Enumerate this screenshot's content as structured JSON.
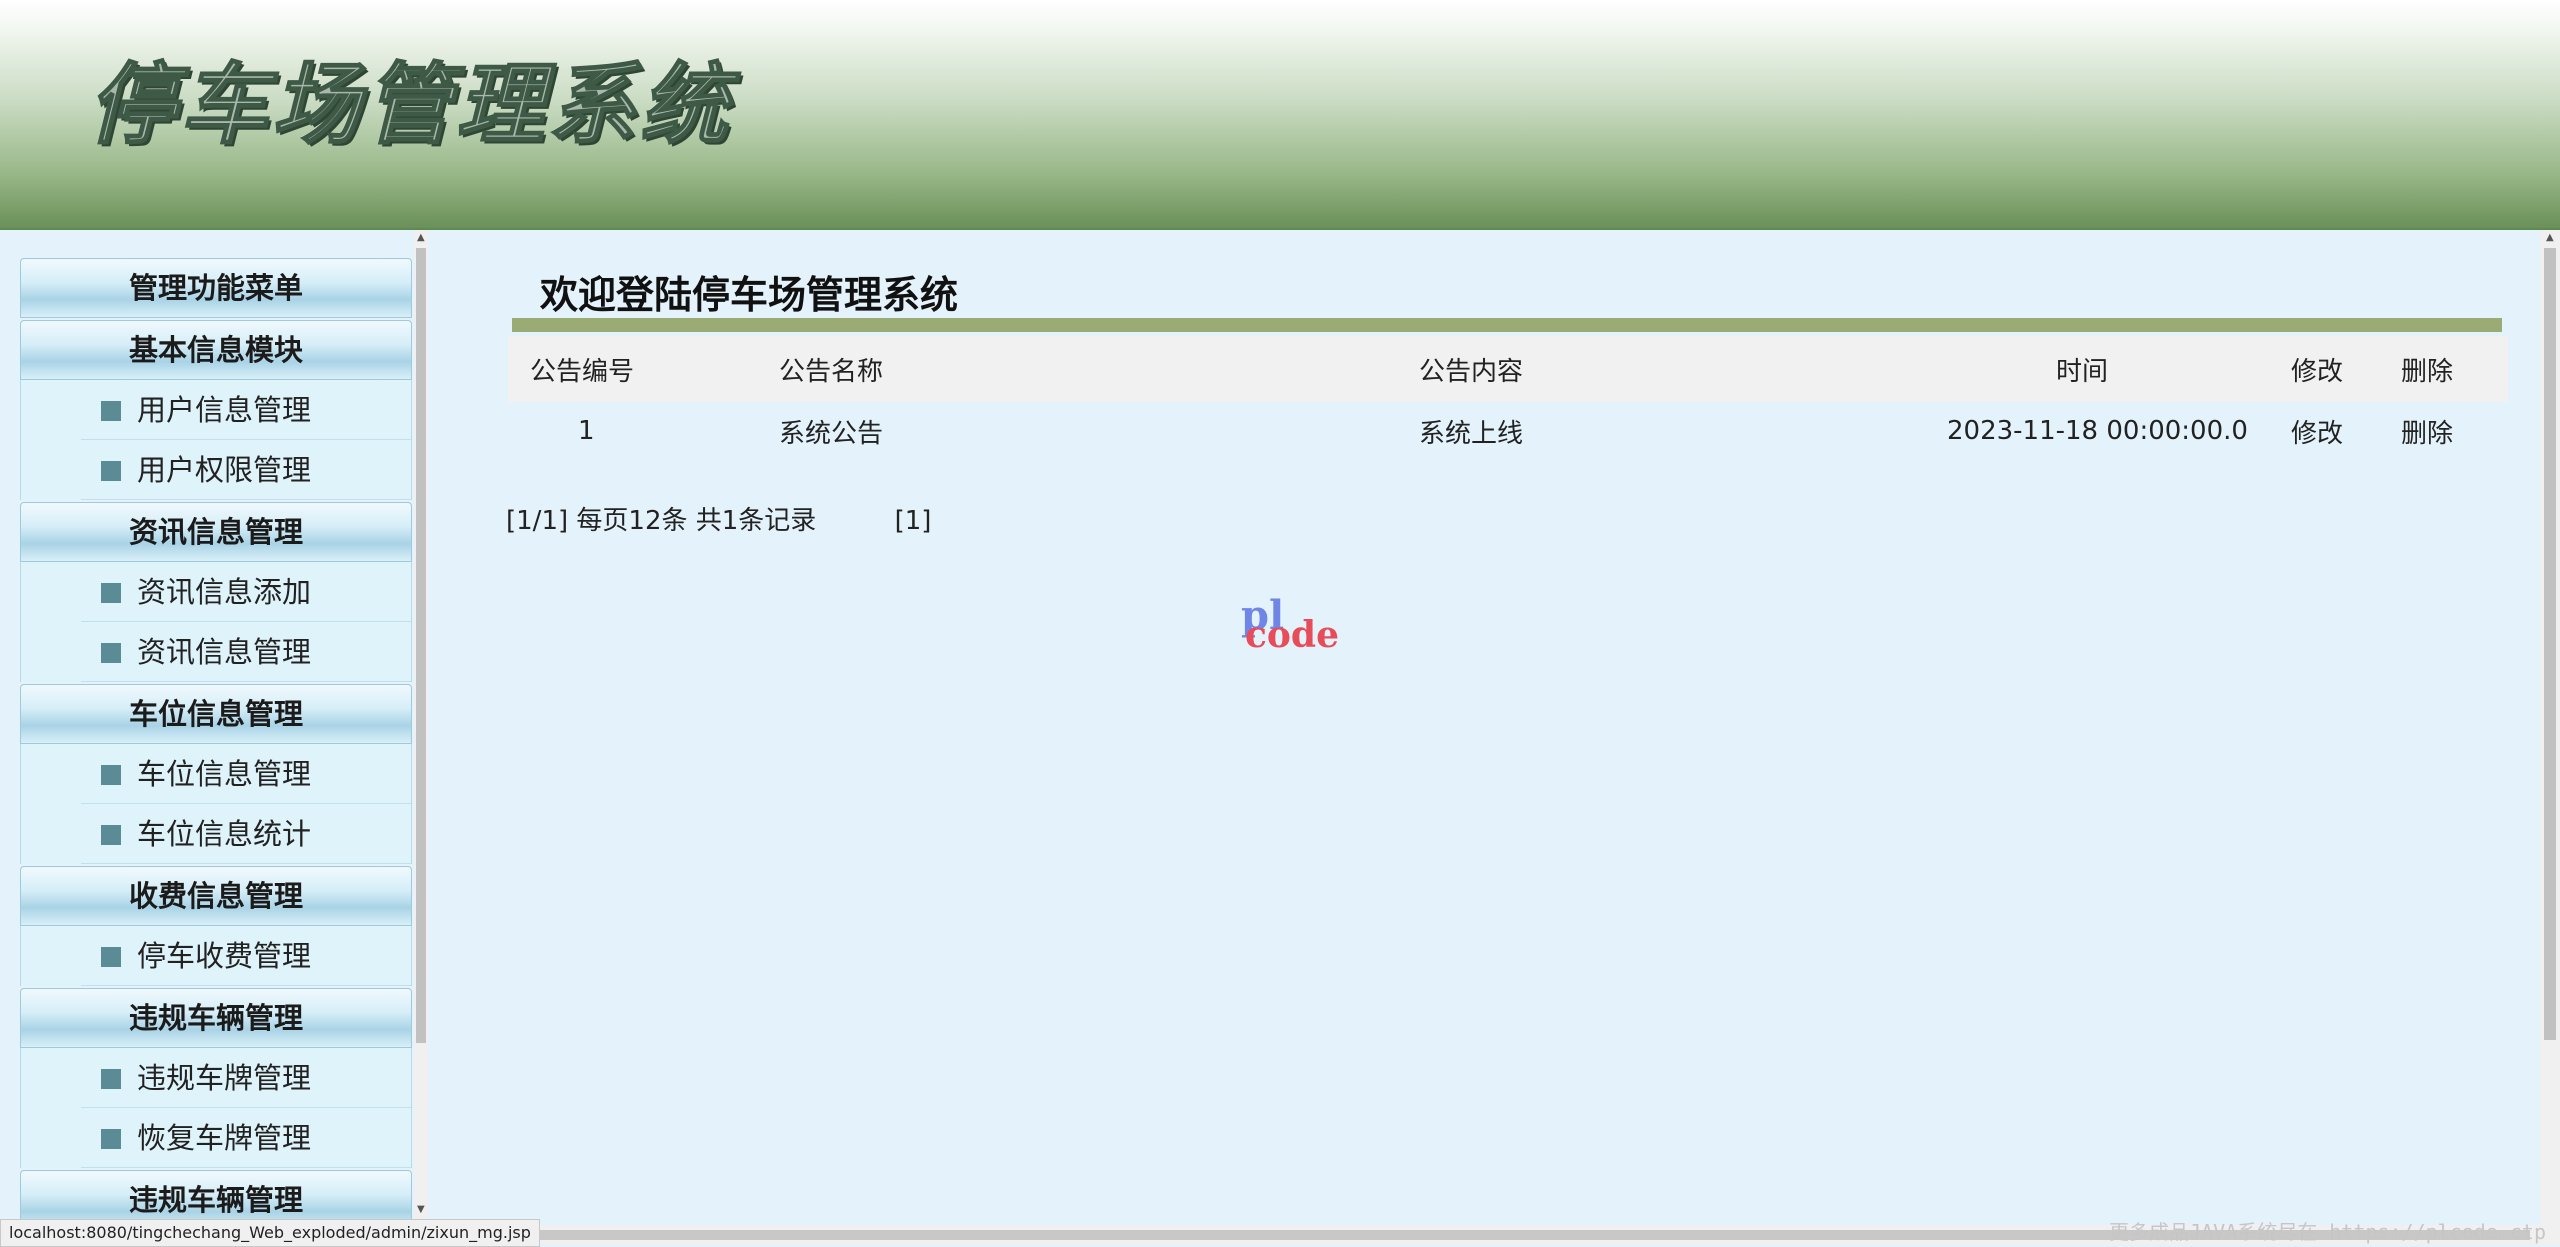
{
  "header": {
    "title": "停车场管理系统"
  },
  "sidebar": {
    "sections": [
      {
        "title": "管理功能菜单",
        "items": []
      },
      {
        "title": "基本信息模块",
        "items": [
          {
            "label": "用户信息管理"
          },
          {
            "label": "用户权限管理"
          }
        ]
      },
      {
        "title": "资讯信息管理",
        "items": [
          {
            "label": "资讯信息添加"
          },
          {
            "label": "资讯信息管理"
          }
        ]
      },
      {
        "title": "车位信息管理",
        "items": [
          {
            "label": "车位信息管理"
          },
          {
            "label": "车位信息统计"
          }
        ]
      },
      {
        "title": "收费信息管理",
        "items": [
          {
            "label": "停车收费管理"
          }
        ]
      },
      {
        "title": "违规车辆管理",
        "items": [
          {
            "label": "违规车牌管理"
          },
          {
            "label": "恢复车牌管理"
          }
        ]
      },
      {
        "title": "违规车辆管理",
        "items": []
      }
    ]
  },
  "main": {
    "welcome": "欢迎登陆停车场管理系统",
    "table": {
      "headers": [
        "公告编号",
        "公告名称",
        "公告内容",
        "时间",
        "修改",
        "删除"
      ],
      "rows": [
        {
          "id": "1",
          "name": "系统公告",
          "content": "系统上线",
          "time": "2023-11-18 00:00:00.0",
          "edit": "修改",
          "delete": "删除"
        }
      ]
    },
    "pager": {
      "info": "[1/1] 每页12条 共1条记录",
      "page": "[1]"
    }
  },
  "logo": {
    "pl": "pl",
    "code": "code"
  },
  "status_url": "localhost:8080/tingchechang_Web_exploded/admin/zixun_mg.jsp",
  "watermark": "更多成品JAVA系统尽在 https://plcode.ctp"
}
